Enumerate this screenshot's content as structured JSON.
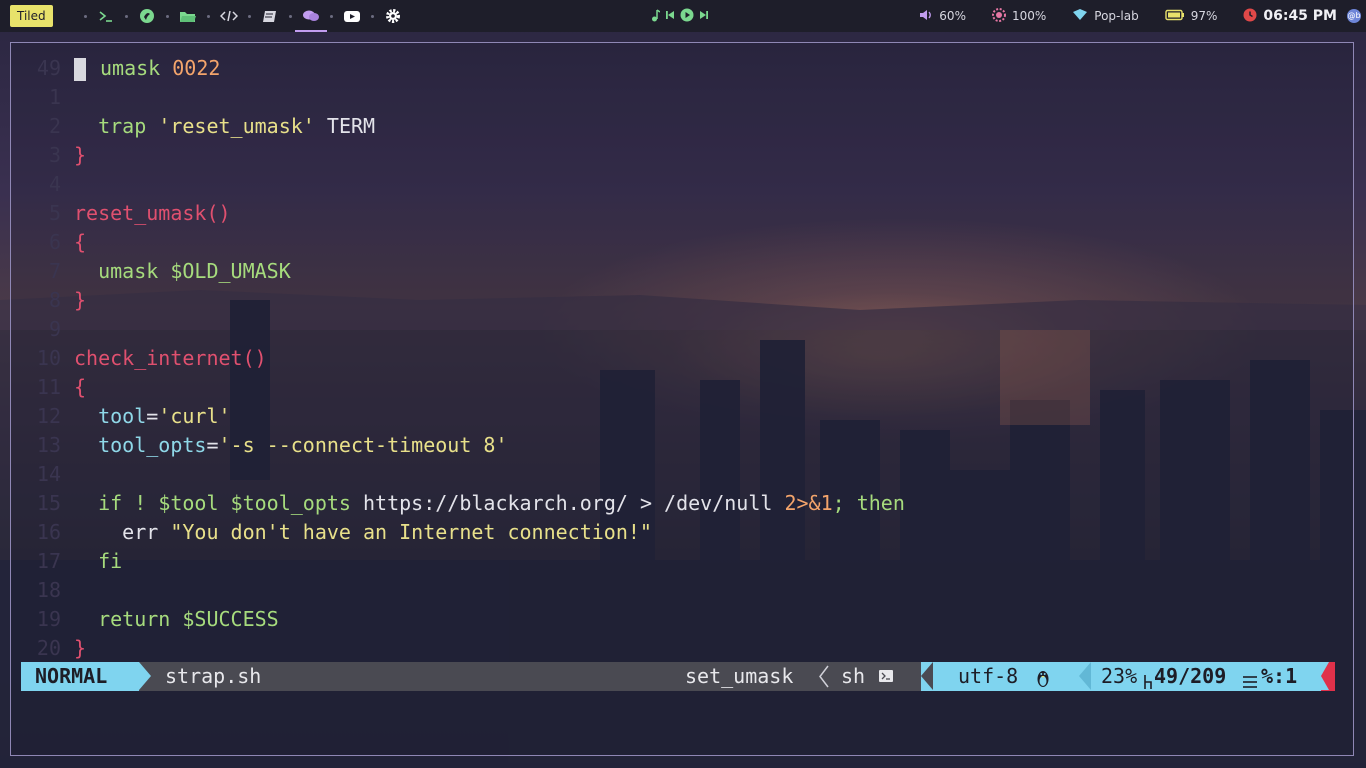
{
  "topbar": {
    "layout_mode": "Tiled",
    "workspaces": [
      {
        "icon": "terminal-icon",
        "color": "#7bd88f"
      },
      {
        "icon": "brush-icon",
        "color": "#7bd88f"
      },
      {
        "icon": "folder-icon",
        "color": "#7bd88f"
      },
      {
        "icon": "code-icon",
        "color": "#d7d7e0"
      },
      {
        "icon": "book-icon",
        "color": "#d7d7e0"
      },
      {
        "icon": "chat-icon",
        "color": "#c29df0",
        "active": true
      },
      {
        "icon": "youtube-icon",
        "color": "#ffffff"
      },
      {
        "icon": "gear-icon",
        "color": "#ffffff"
      }
    ],
    "media": [
      "music-icon",
      "prev-icon",
      "play-icon",
      "next-icon"
    ],
    "volume": "60%",
    "brightness": "100%",
    "network": "Pop-lab",
    "battery": "97%",
    "time": "06:45 PM",
    "avatar_text": "@b"
  },
  "editor": {
    "lines": [
      {
        "num": "49",
        "parts": [
          [
            "k",
            "umask "
          ],
          [
            "n",
            "0022"
          ]
        ],
        "cursor": true
      },
      {
        "num": "1",
        "parts": []
      },
      {
        "num": "2",
        "parts": [
          [
            "w",
            "  "
          ],
          [
            "k",
            "trap "
          ],
          [
            "s",
            "'reset_umask'"
          ],
          [
            "w",
            " TERM"
          ]
        ]
      },
      {
        "num": "3",
        "parts": [
          [
            "f",
            "}"
          ]
        ]
      },
      {
        "num": "4",
        "parts": []
      },
      {
        "num": "5",
        "parts": [
          [
            "f",
            "reset_umask()"
          ]
        ]
      },
      {
        "num": "6",
        "parts": [
          [
            "f",
            "{"
          ]
        ]
      },
      {
        "num": "7",
        "parts": [
          [
            "w",
            "  "
          ],
          [
            "k",
            "umask "
          ],
          [
            "k",
            "$OLD_UMASK"
          ]
        ]
      },
      {
        "num": "8",
        "parts": [
          [
            "f",
            "}"
          ]
        ]
      },
      {
        "num": "9",
        "parts": []
      },
      {
        "num": "10",
        "parts": [
          [
            "f",
            "check_internet()"
          ]
        ]
      },
      {
        "num": "11",
        "parts": [
          [
            "f",
            "{"
          ]
        ]
      },
      {
        "num": "12",
        "parts": [
          [
            "w",
            "  "
          ],
          [
            "v",
            "tool"
          ],
          [
            "w",
            "="
          ],
          [
            "s",
            "'curl'"
          ]
        ]
      },
      {
        "num": "13",
        "parts": [
          [
            "w",
            "  "
          ],
          [
            "v",
            "tool_opts"
          ],
          [
            "w",
            "="
          ],
          [
            "s",
            "'-s --connect-timeout 8'"
          ]
        ]
      },
      {
        "num": "14",
        "parts": []
      },
      {
        "num": "15",
        "parts": [
          [
            "w",
            "  "
          ],
          [
            "k",
            "if ! "
          ],
          [
            "k",
            "$tool $tool_opts "
          ],
          [
            "w",
            "https://blackarch.org/ > /dev/null "
          ],
          [
            "n",
            "2>&1"
          ],
          [
            "k",
            "; then"
          ]
        ]
      },
      {
        "num": "16",
        "parts": [
          [
            "w",
            "    err "
          ],
          [
            "s",
            "\"You don't have an Internet connection!\""
          ]
        ]
      },
      {
        "num": "17",
        "parts": [
          [
            "w",
            "  "
          ],
          [
            "k",
            "fi"
          ]
        ]
      },
      {
        "num": "18",
        "parts": []
      },
      {
        "num": "19",
        "parts": [
          [
            "w",
            "  "
          ],
          [
            "k",
            "return "
          ],
          [
            "k",
            "$SUCCESS"
          ]
        ]
      },
      {
        "num": "20",
        "parts": [
          [
            "f",
            "}"
          ]
        ]
      }
    ]
  },
  "statusline": {
    "mode": "NORMAL",
    "filename": "strap.sh",
    "function": "set_umask",
    "filetype": "sh",
    "encoding": "utf-8",
    "percent": "23%",
    "line_info": "49/209",
    "column": "%:1",
    "colors": {
      "mode_bg": "#7fd4ef",
      "bar_bg": "#4a4a52",
      "tip": "#e0314a"
    }
  }
}
